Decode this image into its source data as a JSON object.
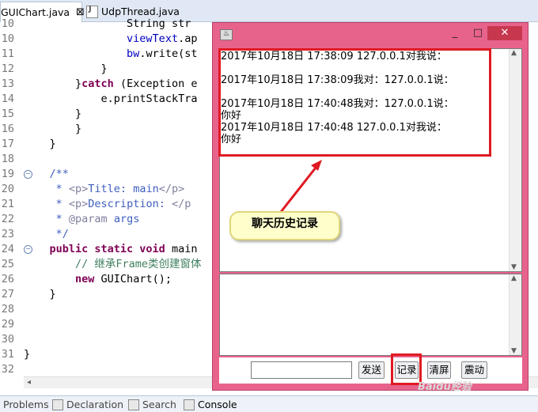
{
  "editor_tabs": [
    {
      "label": "GUIChart.java",
      "close": "⊠"
    },
    {
      "label": "UdpThread.java"
    }
  ],
  "code": {
    "lines": [
      {
        "num": "10",
        "indent": "                ",
        "parts": [
          [
            "",
            "String str"
          ]
        ]
      },
      {
        "num": "10",
        "indent": "                ",
        "parts": [
          [
            "fn",
            "viewText"
          ],
          [
            "",
            ".ap"
          ]
        ]
      },
      {
        "num": "11",
        "indent": "                ",
        "parts": [
          [
            "fn",
            "bw"
          ],
          [
            "",
            ".write(st"
          ]
        ]
      },
      {
        "num": "12",
        "indent": "            ",
        "parts": [
          [
            "",
            "}"
          ]
        ]
      },
      {
        "num": "13",
        "indent": "        ",
        "parts": [
          [
            "",
            "}"
          ],
          [
            "kw",
            "catch"
          ],
          [
            "",
            " (Exception e"
          ]
        ]
      },
      {
        "num": "14",
        "indent": "            ",
        "parts": [
          [
            "",
            "e.printStackTra"
          ]
        ]
      },
      {
        "num": "15",
        "indent": "        ",
        "parts": [
          [
            "",
            "}"
          ]
        ]
      },
      {
        "num": "16",
        "indent": "        ",
        "parts": [
          [
            "",
            "}"
          ]
        ]
      },
      {
        "num": "17",
        "indent": "    ",
        "parts": [
          [
            "",
            "}"
          ]
        ]
      },
      {
        "num": "18",
        "indent": "",
        "parts": []
      },
      {
        "num": "19",
        "indent": "    ",
        "parts": [
          [
            "jd",
            "/**"
          ]
        ],
        "fold": true
      },
      {
        "num": "20",
        "indent": "     ",
        "parts": [
          [
            "jd",
            "* "
          ],
          [
            "jdt",
            "<p>"
          ],
          [
            "jd",
            "Title: main"
          ],
          [
            "jdt",
            "</p>"
          ]
        ]
      },
      {
        "num": "21",
        "indent": "     ",
        "parts": [
          [
            "jd",
            "* "
          ],
          [
            "jdt",
            "<p>"
          ],
          [
            "jd",
            "Description: "
          ],
          [
            "jdt",
            "</p"
          ]
        ]
      },
      {
        "num": "22",
        "indent": "     ",
        "parts": [
          [
            "jd",
            "* "
          ],
          [
            "jdt",
            "@param"
          ],
          [
            "jd",
            " args"
          ]
        ]
      },
      {
        "num": "23",
        "indent": "     ",
        "parts": [
          [
            "jd",
            "*/"
          ]
        ]
      },
      {
        "num": "24",
        "indent": "    ",
        "parts": [
          [
            "kw",
            "public static void"
          ],
          [
            "",
            " main"
          ]
        ],
        "fold": true
      },
      {
        "num": "25",
        "indent": "        ",
        "parts": [
          [
            "cm",
            "// 继承Frame类创建窗体"
          ]
        ]
      },
      {
        "num": "26",
        "indent": "        ",
        "parts": [
          [
            "kw",
            "new"
          ],
          [
            "",
            " GUIChart();"
          ]
        ]
      },
      {
        "num": "27",
        "indent": "    ",
        "parts": [
          [
            "",
            "}"
          ]
        ]
      },
      {
        "num": "28",
        "indent": "",
        "parts": []
      },
      {
        "num": "29",
        "indent": "",
        "parts": []
      },
      {
        "num": "30",
        "indent": "",
        "parts": []
      },
      {
        "num": "31",
        "indent": "",
        "parts": [
          [
            "",
            "}"
          ]
        ]
      },
      {
        "num": "32",
        "indent": "",
        "parts": []
      }
    ]
  },
  "bottom_tabs": [
    "Problems",
    "Declaration",
    "Search",
    "Console"
  ],
  "chat_window": {
    "icon_label": "♨",
    "controls": {
      "minimize": "_",
      "maximize": "□",
      "close": "✕"
    },
    "history": [
      "2017年10月18日 17:38:09 127.0.0.1对我说：",
      "",
      "2017年10月18日 17:38:09我对：127.0.0.1说：",
      "",
      "2017年10月18日 17:40:48我对：127.0.0.1说：",
      "你好",
      "2017年10月18日 17:40:48 127.0.0.1对我说：",
      "你好"
    ],
    "input_value": "",
    "buttons": {
      "send": "发送",
      "record": "记录",
      "clear": "清屏",
      "shake": "震动"
    }
  },
  "annotation": {
    "callout_text": "聊天历史记录",
    "color": "#e01a22"
  },
  "watermark": "Baidu经验"
}
